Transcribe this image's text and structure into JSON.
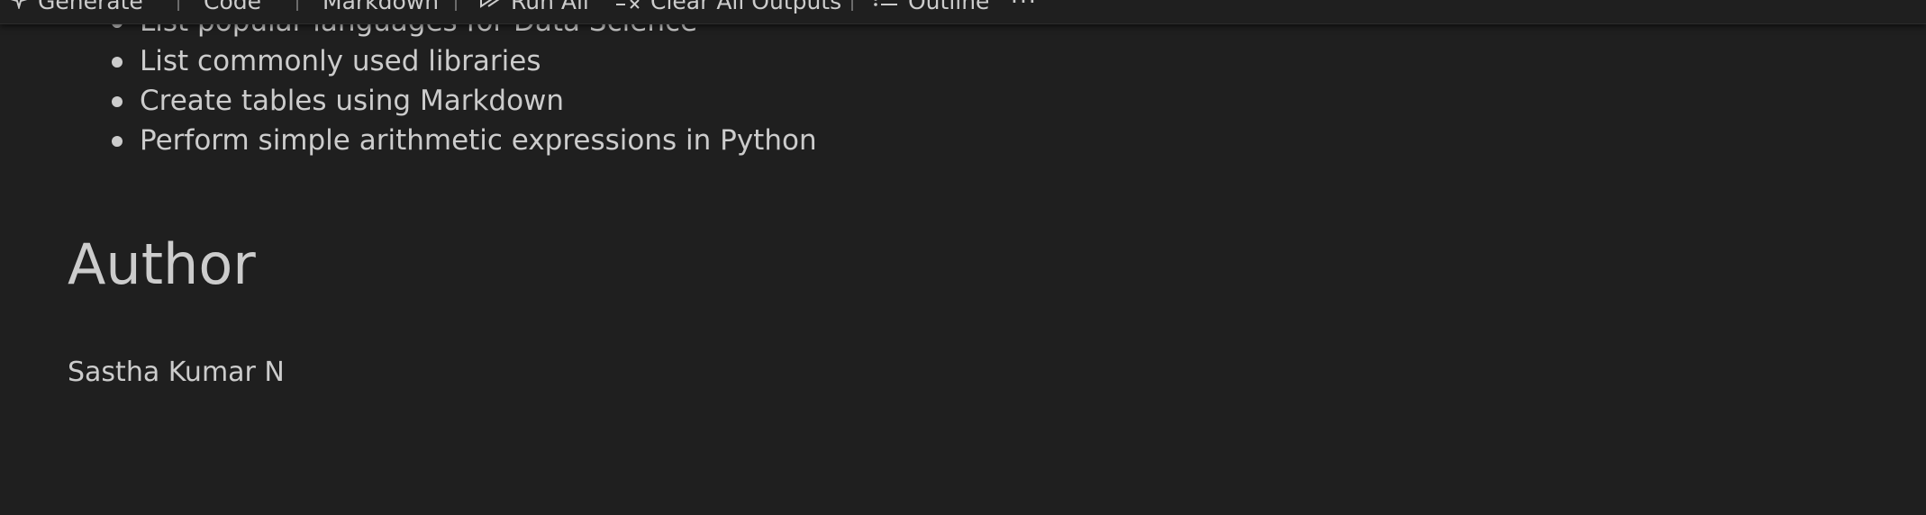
{
  "toolbar": {
    "generate": "Generate",
    "code": "Code",
    "markdown": "Markdown",
    "run_all": "Run All",
    "clear_all_outputs": "Clear All Outputs",
    "outline": "Outline",
    "more": "···"
  },
  "markdown": {
    "bullets": [
      "List popular languages for Data Science",
      "List commonly used libraries",
      "Create tables using Markdown",
      "Perform simple arithmetic expressions in Python"
    ],
    "heading": "Author",
    "author": "Sastha Kumar N"
  },
  "icons": {
    "generate": "sparkle-icon",
    "run_all": "run-all-icon",
    "clear_all_outputs": "clear-outputs-icon",
    "outline": "list-icon",
    "more": "more-icon"
  },
  "colors": {
    "background": "#1f1f1f",
    "text": "#cccccc"
  }
}
